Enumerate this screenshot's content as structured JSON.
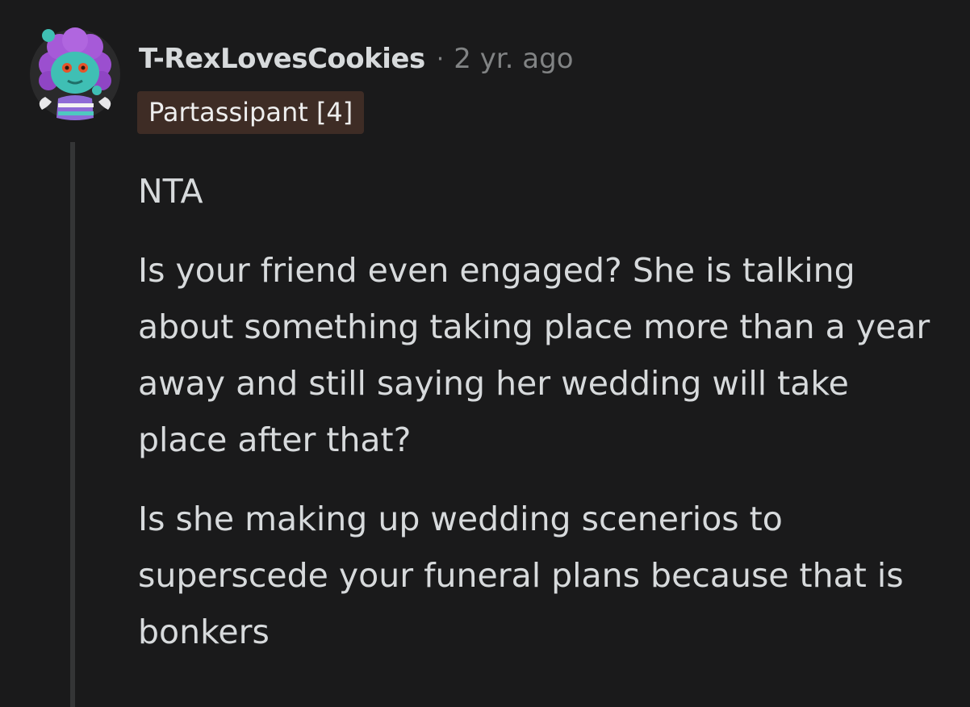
{
  "comment": {
    "author": "T-RexLovesCookies",
    "separator": "·",
    "age": "2 yr. ago",
    "flair": "Partassipant [4]",
    "paragraphs": [
      "NTA",
      "Is your friend even engaged? She is talking about something taking place more than a year away and still saying her wedding will take place after that?",
      "Is she making up wedding scenerios to superscede your funeral plans because that is bonkers"
    ]
  },
  "colors": {
    "background": "#1a1a1b",
    "text": "#d7dadc",
    "muted": "#818384",
    "flair_bg": "#3e2c25",
    "thread_line": "#343536"
  },
  "icons": {
    "avatar": "snoo-avatar-icon"
  }
}
